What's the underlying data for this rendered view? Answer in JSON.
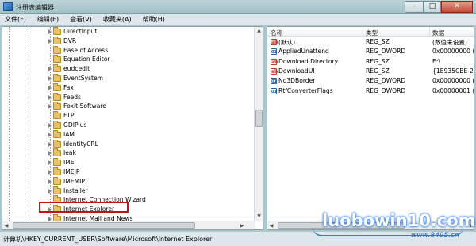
{
  "window": {
    "title": "注册表编辑器",
    "controls": {
      "minimize": "–",
      "maximize": "□",
      "close": "✕"
    }
  },
  "menu": [
    "文件(F)",
    "编辑(E)",
    "查看(V)",
    "收藏夹(A)",
    "帮助(H)"
  ],
  "tree": {
    "items": [
      {
        "label": "DirectInput",
        "expander": true
      },
      {
        "label": "DVR",
        "expander": true
      },
      {
        "label": "Ease of Access",
        "expander": false
      },
      {
        "label": "Equation Editor",
        "expander": false
      },
      {
        "label": "eudcedit",
        "expander": true
      },
      {
        "label": "EventSystem",
        "expander": true
      },
      {
        "label": "Fax",
        "expander": true
      },
      {
        "label": "Feeds",
        "expander": true
      },
      {
        "label": "Foxit Software",
        "expander": true
      },
      {
        "label": "FTP",
        "expander": false
      },
      {
        "label": "GDIPlus",
        "expander": true
      },
      {
        "label": "IAM",
        "expander": true
      },
      {
        "label": "IdentityCRL",
        "expander": true
      },
      {
        "label": "Ieak",
        "expander": true
      },
      {
        "label": "IME",
        "expander": true
      },
      {
        "label": "IMEJP",
        "expander": true
      },
      {
        "label": "IMEMIP",
        "expander": true
      },
      {
        "label": "Installer",
        "expander": true
      },
      {
        "label": "Internet Connection Wizard",
        "expander": false
      },
      {
        "label": "Internet Explorer",
        "expander": true,
        "selected": true
      },
      {
        "label": "Internet Mail and News",
        "expander": true
      },
      {
        "label": "InternetExplorer",
        "expander": true
      }
    ]
  },
  "values": {
    "headers": {
      "name": "名称",
      "type": "类型",
      "data": "数据"
    },
    "rows": [
      {
        "icon": "string-value-icon",
        "name": "(默认)",
        "type": "REG_SZ",
        "data": "(数值未设置)"
      },
      {
        "icon": "dword-value-icon",
        "name": "AppliedUnattend",
        "type": "REG_DWORD",
        "data": "0x00000000 (0"
      },
      {
        "icon": "string-value-icon",
        "name": "Download Directory",
        "type": "REG_SZ",
        "data": "E:\\"
      },
      {
        "icon": "string-value-icon",
        "name": "DownloadUI",
        "type": "REG_SZ",
        "data": "{1E935CBE-29"
      },
      {
        "icon": "dword-value-icon",
        "name": "No3DBorder",
        "type": "REG_DWORD",
        "data": "0x00000000 (0"
      },
      {
        "icon": "dword-value-icon",
        "name": "RtfConverterFlags",
        "type": "REG_DWORD",
        "data": "0x00000001 (1"
      }
    ]
  },
  "status": {
    "path": "计算机\\HKEY_CURRENT_USER\\Software\\Microsoft\\Internet Explorer"
  },
  "watermark": {
    "text": "luobowin10.com",
    "sub": "www.8495.cn"
  },
  "colors": {
    "highlight": "#c0141b",
    "titlebar": "#a9c7cc",
    "watermark": "#1a6ad8"
  }
}
